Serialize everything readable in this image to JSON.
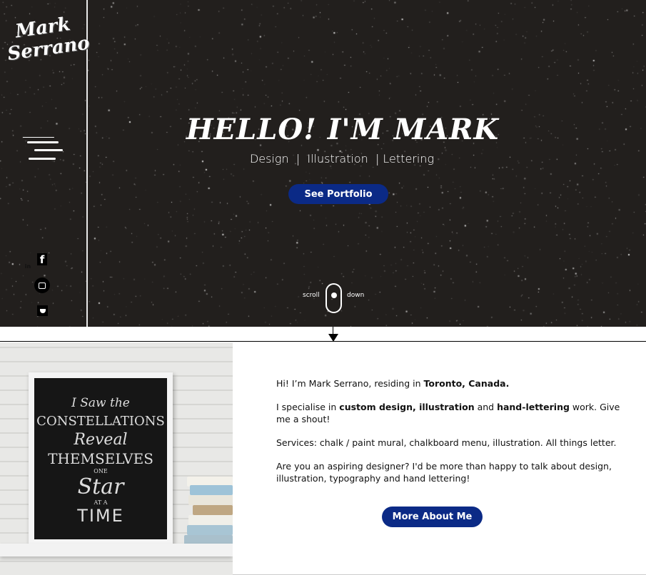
{
  "sidebar": {
    "logo": "Mark Serrano",
    "social": {
      "facebook": "f",
      "linkedin": "in",
      "instagram": "◙",
      "twitter": "🐦"
    }
  },
  "hero": {
    "title": "HELLO! I'M MARK",
    "subtitle": "Design  |  Illustration  | Lettering",
    "cta": "See Portfolio",
    "scroll_left": "scroll",
    "scroll_right": "down"
  },
  "artwork": {
    "lines": [
      "I Saw the",
      "CONSTELLATIONS",
      "Reveal",
      "THEMSELVES",
      "ONE",
      "Star",
      "AT A",
      "TIME"
    ]
  },
  "about": {
    "p1": [
      "Hi! I’m Mark Serrano, residing in ",
      "Toronto, Canada."
    ],
    "p2": [
      "I specialise in ",
      "custom design, illustration",
      " and ",
      "hand-lettering",
      " work. Give me a shout!"
    ],
    "p3": "Services: chalk / paint mural, chalkboard menu, illustration. All things letter.",
    "p4": "Are you an aspiring designer? I'd be more than happy to talk about design, illustration, typography and hand lettering!",
    "cta": "More About Me"
  },
  "colors": {
    "accent": "#0b2a86",
    "hero_bg": "#221f1d"
  }
}
